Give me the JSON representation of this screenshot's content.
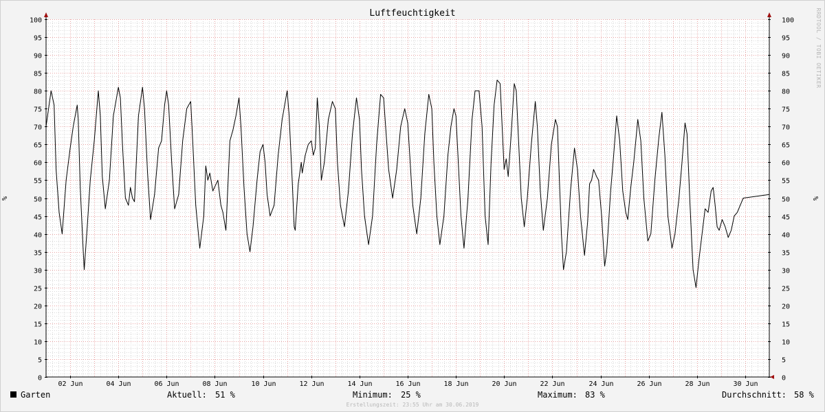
{
  "chart_data": {
    "type": "line",
    "title": "Luftfeuchtigkeit",
    "ylabel": "%",
    "ylim": [
      0,
      100
    ],
    "yticks": [
      0,
      5,
      10,
      15,
      20,
      25,
      30,
      35,
      40,
      45,
      50,
      55,
      60,
      65,
      70,
      75,
      80,
      85,
      90,
      95,
      100
    ],
    "xlim": [
      "2019-06-01T00:00",
      "2019-06-30T23:55"
    ],
    "xticks": [
      {
        "date": "2019-06-02",
        "label": "02 Jun"
      },
      {
        "date": "2019-06-04",
        "label": "04 Jun"
      },
      {
        "date": "2019-06-06",
        "label": "06 Jun"
      },
      {
        "date": "2019-06-08",
        "label": "08 Jun"
      },
      {
        "date": "2019-06-10",
        "label": "10 Jun"
      },
      {
        "date": "2019-06-12",
        "label": "12 Jun"
      },
      {
        "date": "2019-06-14",
        "label": "14 Jun"
      },
      {
        "date": "2019-06-16",
        "label": "16 Jun"
      },
      {
        "date": "2019-06-18",
        "label": "18 Jun"
      },
      {
        "date": "2019-06-20",
        "label": "20 Jun"
      },
      {
        "date": "2019-06-22",
        "label": "22 Jun"
      },
      {
        "date": "2019-06-24",
        "label": "24 Jun"
      },
      {
        "date": "2019-06-26",
        "label": "26 Jun"
      },
      {
        "date": "2019-06-28",
        "label": "28 Jun"
      },
      {
        "date": "2019-06-30",
        "label": "30 Jun"
      }
    ],
    "grid": true,
    "series": [
      {
        "name": "Garten",
        "color": "#000000",
        "points": [
          [
            "2019-06-01T00:00",
            70
          ],
          [
            "2019-06-01T05:00",
            80
          ],
          [
            "2019-06-01T08:00",
            76
          ],
          [
            "2019-06-01T10:00",
            58
          ],
          [
            "2019-06-01T13:00",
            46
          ],
          [
            "2019-06-01T16:00",
            40
          ],
          [
            "2019-06-01T20:00",
            55
          ],
          [
            "2019-06-02T00:00",
            64
          ],
          [
            "2019-06-02T03:00",
            70
          ],
          [
            "2019-06-02T07:00",
            76
          ],
          [
            "2019-06-02T08:00",
            72
          ],
          [
            "2019-06-02T10:00",
            53
          ],
          [
            "2019-06-02T13:00",
            35
          ],
          [
            "2019-06-02T14:00",
            30
          ],
          [
            "2019-06-02T17:00",
            42
          ],
          [
            "2019-06-02T20:00",
            55
          ],
          [
            "2019-06-03T00:00",
            66
          ],
          [
            "2019-06-03T04:00",
            80
          ],
          [
            "2019-06-03T06:00",
            73
          ],
          [
            "2019-06-03T08:00",
            56
          ],
          [
            "2019-06-03T11:00",
            47
          ],
          [
            "2019-06-03T15:00",
            55
          ],
          [
            "2019-06-03T19:00",
            73
          ],
          [
            "2019-06-04T00:00",
            81
          ],
          [
            "2019-06-04T02:00",
            78
          ],
          [
            "2019-06-04T04:00",
            65
          ],
          [
            "2019-06-04T07:00",
            50
          ],
          [
            "2019-06-04T10:00",
            48
          ],
          [
            "2019-06-04T12:00",
            53
          ],
          [
            "2019-06-04T14:00",
            50
          ],
          [
            "2019-06-04T16:00",
            49
          ],
          [
            "2019-06-04T20:00",
            73
          ],
          [
            "2019-06-05T00:00",
            81
          ],
          [
            "2019-06-05T02:00",
            75
          ],
          [
            "2019-06-05T05:00",
            57
          ],
          [
            "2019-06-05T08:00",
            44
          ],
          [
            "2019-06-05T12:00",
            51
          ],
          [
            "2019-06-05T16:00",
            64
          ],
          [
            "2019-06-05T19:00",
            66
          ],
          [
            "2019-06-05T22:00",
            76
          ],
          [
            "2019-06-06T00:00",
            80
          ],
          [
            "2019-06-06T02:00",
            76
          ],
          [
            "2019-06-06T05:00",
            60
          ],
          [
            "2019-06-06T08:00",
            47
          ],
          [
            "2019-06-06T12:00",
            51
          ],
          [
            "2019-06-06T16:00",
            66
          ],
          [
            "2019-06-06T20:00",
            75
          ],
          [
            "2019-06-07T00:00",
            77
          ],
          [
            "2019-06-07T02:00",
            66
          ],
          [
            "2019-06-07T05:00",
            48
          ],
          [
            "2019-06-07T09:00",
            36
          ],
          [
            "2019-06-07T13:00",
            45
          ],
          [
            "2019-06-07T15:00",
            59
          ],
          [
            "2019-06-07T17:00",
            55
          ],
          [
            "2019-06-07T19:00",
            57
          ],
          [
            "2019-06-07T22:00",
            52
          ],
          [
            "2019-06-08T03:00",
            55
          ],
          [
            "2019-06-08T06:00",
            48
          ],
          [
            "2019-06-08T08:00",
            46
          ],
          [
            "2019-06-08T11:00",
            41
          ],
          [
            "2019-06-08T15:00",
            66
          ],
          [
            "2019-06-08T18:00",
            69
          ],
          [
            "2019-06-08T21:00",
            73
          ],
          [
            "2019-06-09T00:00",
            78
          ],
          [
            "2019-06-09T02:00",
            70
          ],
          [
            "2019-06-09T05:00",
            53
          ],
          [
            "2019-06-09T08:00",
            40
          ],
          [
            "2019-06-09T11:00",
            35
          ],
          [
            "2019-06-09T14:00",
            42
          ],
          [
            "2019-06-09T18:00",
            55
          ],
          [
            "2019-06-09T21:00",
            63
          ],
          [
            "2019-06-10T00:00",
            65
          ],
          [
            "2019-06-10T02:00",
            60
          ],
          [
            "2019-06-10T04:00",
            51
          ],
          [
            "2019-06-10T07:00",
            45
          ],
          [
            "2019-06-10T11:00",
            48
          ],
          [
            "2019-06-10T15:00",
            62
          ],
          [
            "2019-06-10T19:00",
            72
          ],
          [
            "2019-06-11T00:00",
            80
          ],
          [
            "2019-06-11T02:00",
            73
          ],
          [
            "2019-06-11T05:00",
            55
          ],
          [
            "2019-06-11T07:00",
            42
          ],
          [
            "2019-06-11T08:00",
            41
          ],
          [
            "2019-06-11T11:00",
            54
          ],
          [
            "2019-06-11T14:00",
            60
          ],
          [
            "2019-06-11T15:00",
            57
          ],
          [
            "2019-06-11T18:00",
            62
          ],
          [
            "2019-06-11T21:00",
            65
          ],
          [
            "2019-06-12T00:00",
            66
          ],
          [
            "2019-06-12T02:00",
            62
          ],
          [
            "2019-06-12T04:00",
            64
          ],
          [
            "2019-06-12T06:00",
            78
          ],
          [
            "2019-06-12T08:00",
            70
          ],
          [
            "2019-06-12T10:00",
            55
          ],
          [
            "2019-06-12T13:00",
            60
          ],
          [
            "2019-06-12T17:00",
            72
          ],
          [
            "2019-06-12T21:00",
            77
          ],
          [
            "2019-06-13T00:00",
            75
          ],
          [
            "2019-06-13T02:00",
            60
          ],
          [
            "2019-06-13T05:00",
            48
          ],
          [
            "2019-06-13T09:00",
            42
          ],
          [
            "2019-06-13T13:00",
            52
          ],
          [
            "2019-06-13T17:00",
            68
          ],
          [
            "2019-06-13T21:00",
            78
          ],
          [
            "2019-06-14T00:00",
            72
          ],
          [
            "2019-06-14T02:00",
            58
          ],
          [
            "2019-06-14T05:00",
            45
          ],
          [
            "2019-06-14T09:00",
            37
          ],
          [
            "2019-06-14T13:00",
            45
          ],
          [
            "2019-06-14T17:00",
            65
          ],
          [
            "2019-06-14T21:00",
            79
          ],
          [
            "2019-06-15T00:00",
            78
          ],
          [
            "2019-06-15T02:00",
            70
          ],
          [
            "2019-06-15T05:00",
            58
          ],
          [
            "2019-06-15T09:00",
            50
          ],
          [
            "2019-06-15T13:00",
            58
          ],
          [
            "2019-06-15T17:00",
            70
          ],
          [
            "2019-06-15T21:00",
            75
          ],
          [
            "2019-06-16T00:00",
            71
          ],
          [
            "2019-06-16T02:00",
            62
          ],
          [
            "2019-06-16T05:00",
            48
          ],
          [
            "2019-06-16T09:00",
            40
          ],
          [
            "2019-06-16T13:00",
            50
          ],
          [
            "2019-06-16T17:00",
            68
          ],
          [
            "2019-06-16T21:00",
            79
          ],
          [
            "2019-06-17T00:00",
            75
          ],
          [
            "2019-06-17T02:00",
            60
          ],
          [
            "2019-06-17T05:00",
            45
          ],
          [
            "2019-06-17T08:00",
            37
          ],
          [
            "2019-06-17T12:00",
            45
          ],
          [
            "2019-06-17T16:00",
            62
          ],
          [
            "2019-06-17T19:00",
            70
          ],
          [
            "2019-06-17T22:00",
            75
          ],
          [
            "2019-06-18T00:00",
            73
          ],
          [
            "2019-06-18T02:00",
            62
          ],
          [
            "2019-06-18T05:00",
            45
          ],
          [
            "2019-06-18T08:00",
            36
          ],
          [
            "2019-06-18T12:00",
            50
          ],
          [
            "2019-06-18T16:00",
            72
          ],
          [
            "2019-06-18T19:00",
            80
          ],
          [
            "2019-06-18T23:00",
            80
          ],
          [
            "2019-06-19T02:00",
            70
          ],
          [
            "2019-06-19T05:00",
            45
          ],
          [
            "2019-06-19T08:00",
            37
          ],
          [
            "2019-06-19T11:00",
            60
          ],
          [
            "2019-06-19T14:00",
            76
          ],
          [
            "2019-06-19T17:00",
            83
          ],
          [
            "2019-06-19T20:00",
            82
          ],
          [
            "2019-06-19T22:00",
            70
          ],
          [
            "2019-06-20T00:00",
            58
          ],
          [
            "2019-06-20T02:00",
            61
          ],
          [
            "2019-06-20T04:00",
            56
          ],
          [
            "2019-06-20T07:00",
            68
          ],
          [
            "2019-06-20T10:00",
            82
          ],
          [
            "2019-06-20T12:00",
            80
          ],
          [
            "2019-06-20T14:00",
            68
          ],
          [
            "2019-06-20T17:00",
            50
          ],
          [
            "2019-06-20T20:00",
            42
          ],
          [
            "2019-06-20T23:00",
            50
          ],
          [
            "2019-06-21T03:00",
            65
          ],
          [
            "2019-06-21T07:00",
            77
          ],
          [
            "2019-06-21T09:00",
            70
          ],
          [
            "2019-06-21T12:00",
            52
          ],
          [
            "2019-06-21T15:00",
            41
          ],
          [
            "2019-06-21T19:00",
            50
          ],
          [
            "2019-06-21T23:00",
            65
          ],
          [
            "2019-06-22T03:00",
            72
          ],
          [
            "2019-06-22T05:00",
            70
          ],
          [
            "2019-06-22T07:00",
            55
          ],
          [
            "2019-06-22T09:00",
            40
          ],
          [
            "2019-06-22T11:00",
            30
          ],
          [
            "2019-06-22T14:00",
            35
          ],
          [
            "2019-06-22T18:00",
            52
          ],
          [
            "2019-06-22T22:00",
            64
          ],
          [
            "2019-06-23T01:00",
            58
          ],
          [
            "2019-06-23T04:00",
            45
          ],
          [
            "2019-06-23T08:00",
            34
          ],
          [
            "2019-06-23T11:00",
            43
          ],
          [
            "2019-06-23T13:00",
            54
          ],
          [
            "2019-06-23T15:00",
            55
          ],
          [
            "2019-06-23T17:00",
            58
          ],
          [
            "2019-06-23T20:00",
            56
          ],
          [
            "2019-06-23T22:00",
            55
          ],
          [
            "2019-06-24T01:00",
            45
          ],
          [
            "2019-06-24T04:00",
            31
          ],
          [
            "2019-06-24T06:00",
            35
          ],
          [
            "2019-06-24T07:00",
            39
          ],
          [
            "2019-06-24T10:00",
            52
          ],
          [
            "2019-06-24T13:00",
            62
          ],
          [
            "2019-06-24T16:00",
            73
          ],
          [
            "2019-06-24T19:00",
            66
          ],
          [
            "2019-06-24T22:00",
            52
          ],
          [
            "2019-06-25T01:00",
            46
          ],
          [
            "2019-06-25T03:00",
            44
          ],
          [
            "2019-06-25T06:00",
            53
          ],
          [
            "2019-06-25T09:00",
            60
          ],
          [
            "2019-06-25T13:00",
            72
          ],
          [
            "2019-06-25T16:00",
            66
          ],
          [
            "2019-06-25T19:00",
            50
          ],
          [
            "2019-06-25T23:00",
            38
          ],
          [
            "2019-06-26T02:00",
            40
          ],
          [
            "2019-06-26T06:00",
            55
          ],
          [
            "2019-06-26T10:00",
            67
          ],
          [
            "2019-06-26T13:00",
            74
          ],
          [
            "2019-06-26T16:00",
            62
          ],
          [
            "2019-06-26T19:00",
            45
          ],
          [
            "2019-06-26T23:00",
            36
          ],
          [
            "2019-06-27T02:00",
            40
          ],
          [
            "2019-06-27T06:00",
            50
          ],
          [
            "2019-06-27T09:00",
            60
          ],
          [
            "2019-06-27T12:00",
            71
          ],
          [
            "2019-06-27T14:00",
            68
          ],
          [
            "2019-06-27T17:00",
            48
          ],
          [
            "2019-06-27T20:00",
            30
          ],
          [
            "2019-06-27T23:00",
            25
          ],
          [
            "2019-06-28T02:00",
            33
          ],
          [
            "2019-06-28T05:00",
            40
          ],
          [
            "2019-06-28T08:00",
            47
          ],
          [
            "2019-06-28T11:00",
            46
          ],
          [
            "2019-06-28T14:00",
            52
          ],
          [
            "2019-06-28T16:00",
            53
          ],
          [
            "2019-06-28T18:00",
            48
          ],
          [
            "2019-06-28T20:00",
            42
          ],
          [
            "2019-06-28T22:00",
            41
          ],
          [
            "2019-06-29T01:00",
            44
          ],
          [
            "2019-06-29T04:00",
            42
          ],
          [
            "2019-06-29T07:00",
            39
          ],
          [
            "2019-06-29T10:00",
            41
          ],
          [
            "2019-06-29T13:00",
            45
          ],
          [
            "2019-06-29T16:00",
            46
          ],
          [
            "2019-06-29T19:00",
            48
          ],
          [
            "2019-06-29T22:00",
            50
          ],
          [
            "2019-06-30T23:55",
            51
          ]
        ]
      }
    ]
  },
  "legend": {
    "series_name": "Garten",
    "aktuell_label": "Aktuell:",
    "aktuell_value": "51 %",
    "minimum_label": "Minimum:",
    "minimum_value": "25 %",
    "maximum_label": "Maximum:",
    "maximum_value": "83 %",
    "durchschnitt_label": "Durchschnitt:",
    "durchschnitt_value": "58 %"
  },
  "footer": "Erstellungszeit: 23:55 Uhr am 30.06.2019",
  "watermark": "RRDTOOL / TOBI OETIKER",
  "colors": {
    "background": "#f3f3f3",
    "plot_background": "#ffffff",
    "major_grid": "#e8a0a0",
    "minor_grid": "#d8d8d8",
    "line": "#000000",
    "arrow": "#a01010"
  }
}
